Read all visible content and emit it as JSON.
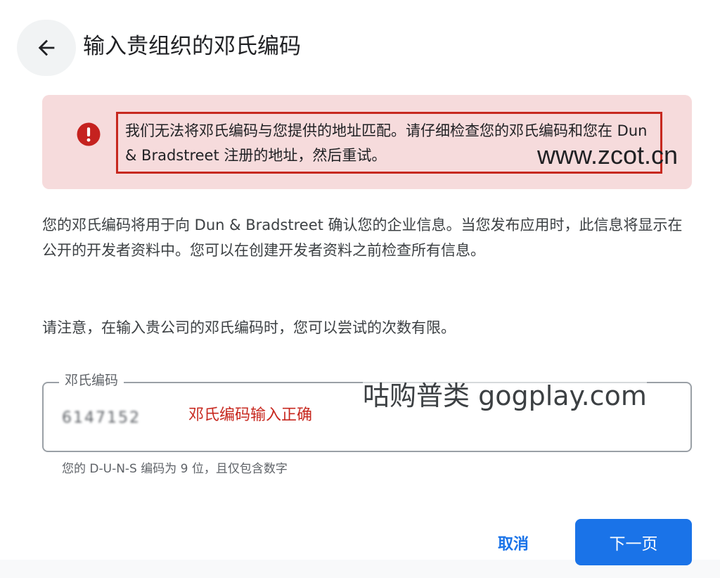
{
  "header": {
    "back_icon": "arrow-back-icon",
    "title": "输入贵组织的邓氏编码"
  },
  "error": {
    "icon": "error-icon",
    "message": "我们无法将邓氏编码与您提供的地址匹配。请仔细检查您的邓氏编码和您在 Dun & Bradstreet 注册的地址，然后重试。",
    "highlight_color": "#c7281f",
    "background_color": "#f6dbdc"
  },
  "watermarks": {
    "zcot": "www.zcot.cn",
    "gogplay": "咕购普类 gogplay.com"
  },
  "content": {
    "description": "您的邓氏编码将用于向 Dun & Bradstreet 确认您的企业信息。当您发布应用时，此信息将显示在公开的开发者资料中。您可以在创建开发者资料之前检查所有信息。",
    "note": "请注意，在输入贵公司的邓氏编码时，您可以尝试的次数有限。"
  },
  "duns_field": {
    "label": "邓氏编码",
    "value": "6147152",
    "annotation": "邓氏编码输入正确",
    "helper": "您的 D-U-N-S 编码为 9 位，且仅包含数字"
  },
  "actions": {
    "cancel_label": "取消",
    "next_label": "下一页",
    "accent_color": "#1a73e8"
  }
}
